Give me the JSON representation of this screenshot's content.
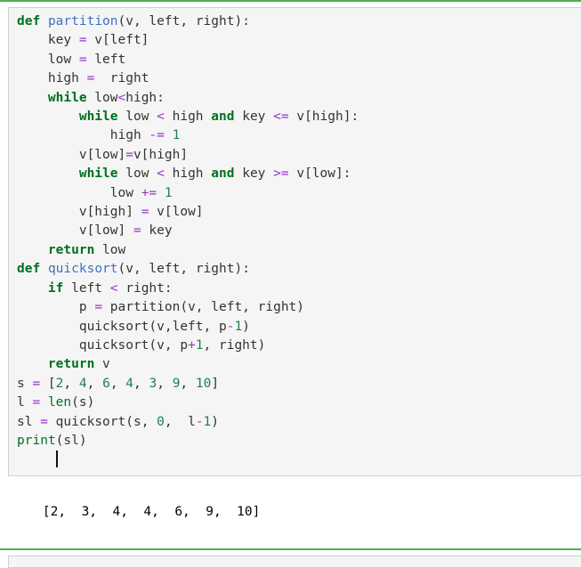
{
  "theme": {
    "divider_color": "#4caf50",
    "cell_background": "#f5f5f5",
    "cell_border": "#cfcfcf",
    "output_background": "#ffffff",
    "keyword_color": "#007020",
    "function_color": "#4070c0",
    "operator_color": "#9935c9",
    "number_color": "#208050",
    "text_color": "#333333"
  },
  "code_cell": {
    "language": "python",
    "lines": [
      [
        {
          "t": "def",
          "c": "k"
        },
        {
          "t": " ",
          "c": "p"
        },
        {
          "t": "partition",
          "c": "nf"
        },
        {
          "t": "(v, left, right):",
          "c": "p"
        }
      ],
      [
        {
          "t": "    key ",
          "c": "n"
        },
        {
          "t": "=",
          "c": "o"
        },
        {
          "t": " v[left]",
          "c": "n"
        }
      ],
      [
        {
          "t": "    low ",
          "c": "n"
        },
        {
          "t": "=",
          "c": "o"
        },
        {
          "t": " left",
          "c": "n"
        }
      ],
      [
        {
          "t": "    high ",
          "c": "n"
        },
        {
          "t": "=",
          "c": "o"
        },
        {
          "t": "  right",
          "c": "n"
        }
      ],
      [
        {
          "t": "    ",
          "c": "n"
        },
        {
          "t": "while",
          "c": "k"
        },
        {
          "t": " low",
          "c": "n"
        },
        {
          "t": "<",
          "c": "o"
        },
        {
          "t": "high:",
          "c": "n"
        }
      ],
      [
        {
          "t": "        ",
          "c": "n"
        },
        {
          "t": "while",
          "c": "k"
        },
        {
          "t": " low ",
          "c": "n"
        },
        {
          "t": "<",
          "c": "o"
        },
        {
          "t": " high ",
          "c": "n"
        },
        {
          "t": "and",
          "c": "k"
        },
        {
          "t": " key ",
          "c": "n"
        },
        {
          "t": "<=",
          "c": "o"
        },
        {
          "t": " v[high]:",
          "c": "n"
        }
      ],
      [
        {
          "t": "            high ",
          "c": "n"
        },
        {
          "t": "-=",
          "c": "o"
        },
        {
          "t": " ",
          "c": "n"
        },
        {
          "t": "1",
          "c": "mi"
        }
      ],
      [
        {
          "t": "        v[low]",
          "c": "n"
        },
        {
          "t": "=",
          "c": "o"
        },
        {
          "t": "v[high]",
          "c": "n"
        }
      ],
      [
        {
          "t": "        ",
          "c": "n"
        },
        {
          "t": "while",
          "c": "k"
        },
        {
          "t": " low ",
          "c": "n"
        },
        {
          "t": "<",
          "c": "o"
        },
        {
          "t": " high ",
          "c": "n"
        },
        {
          "t": "and",
          "c": "k"
        },
        {
          "t": " key ",
          "c": "n"
        },
        {
          "t": ">=",
          "c": "o"
        },
        {
          "t": " v[low]:",
          "c": "n"
        }
      ],
      [
        {
          "t": "            low ",
          "c": "n"
        },
        {
          "t": "+=",
          "c": "o"
        },
        {
          "t": " ",
          "c": "n"
        },
        {
          "t": "1",
          "c": "mi"
        }
      ],
      [
        {
          "t": "        v[high] ",
          "c": "n"
        },
        {
          "t": "=",
          "c": "o"
        },
        {
          "t": " v[low]",
          "c": "n"
        }
      ],
      [
        {
          "t": "        v[low] ",
          "c": "n"
        },
        {
          "t": "=",
          "c": "o"
        },
        {
          "t": " key",
          "c": "n"
        }
      ],
      [
        {
          "t": "    ",
          "c": "n"
        },
        {
          "t": "return",
          "c": "k"
        },
        {
          "t": " low",
          "c": "n"
        }
      ],
      [
        {
          "t": "def",
          "c": "k"
        },
        {
          "t": " ",
          "c": "p"
        },
        {
          "t": "quicksort",
          "c": "nf"
        },
        {
          "t": "(v, left, right):",
          "c": "p"
        }
      ],
      [
        {
          "t": "    ",
          "c": "n"
        },
        {
          "t": "if",
          "c": "k"
        },
        {
          "t": " left ",
          "c": "n"
        },
        {
          "t": "<",
          "c": "o"
        },
        {
          "t": " right:",
          "c": "n"
        }
      ],
      [
        {
          "t": "        p ",
          "c": "n"
        },
        {
          "t": "=",
          "c": "o"
        },
        {
          "t": " partition(v, left, right)",
          "c": "n"
        }
      ],
      [
        {
          "t": "        quicksort(v,left, p",
          "c": "n"
        },
        {
          "t": "-",
          "c": "o"
        },
        {
          "t": "1",
          "c": "mi"
        },
        {
          "t": ")",
          "c": "n"
        }
      ],
      [
        {
          "t": "        quicksort(v, p",
          "c": "n"
        },
        {
          "t": "+",
          "c": "o"
        },
        {
          "t": "1",
          "c": "mi"
        },
        {
          "t": ", right)",
          "c": "n"
        }
      ],
      [
        {
          "t": "    ",
          "c": "n"
        },
        {
          "t": "return",
          "c": "k"
        },
        {
          "t": " v",
          "c": "n"
        }
      ],
      [
        {
          "t": "s ",
          "c": "n"
        },
        {
          "t": "=",
          "c": "o"
        },
        {
          "t": " [",
          "c": "n"
        },
        {
          "t": "2",
          "c": "mi"
        },
        {
          "t": ", ",
          "c": "n"
        },
        {
          "t": "4",
          "c": "mi"
        },
        {
          "t": ", ",
          "c": "n"
        },
        {
          "t": "6",
          "c": "mi"
        },
        {
          "t": ", ",
          "c": "n"
        },
        {
          "t": "4",
          "c": "mi"
        },
        {
          "t": ", ",
          "c": "n"
        },
        {
          "t": "3",
          "c": "mi"
        },
        {
          "t": ", ",
          "c": "n"
        },
        {
          "t": "9",
          "c": "mi"
        },
        {
          "t": ", ",
          "c": "n"
        },
        {
          "t": "10",
          "c": "mi"
        },
        {
          "t": "]",
          "c": "n"
        }
      ],
      [
        {
          "t": "l ",
          "c": "n"
        },
        {
          "t": "=",
          "c": "o"
        },
        {
          "t": " ",
          "c": "n"
        },
        {
          "t": "len",
          "c": "nb"
        },
        {
          "t": "(s)",
          "c": "n"
        }
      ],
      [
        {
          "t": "sl ",
          "c": "n"
        },
        {
          "t": "=",
          "c": "o"
        },
        {
          "t": " quicksort(s, ",
          "c": "n"
        },
        {
          "t": "0",
          "c": "mi"
        },
        {
          "t": ",  l",
          "c": "n"
        },
        {
          "t": "-",
          "c": "o"
        },
        {
          "t": "1",
          "c": "mi"
        },
        {
          "t": ")",
          "c": "n"
        }
      ],
      [
        {
          "t": "print",
          "c": "nb"
        },
        {
          "t": "(sl)",
          "c": "n"
        }
      ]
    ],
    "cursor_line_indent": "     "
  },
  "output": {
    "text": "[2,  3,  4,  4,  6,  9,  10]"
  }
}
